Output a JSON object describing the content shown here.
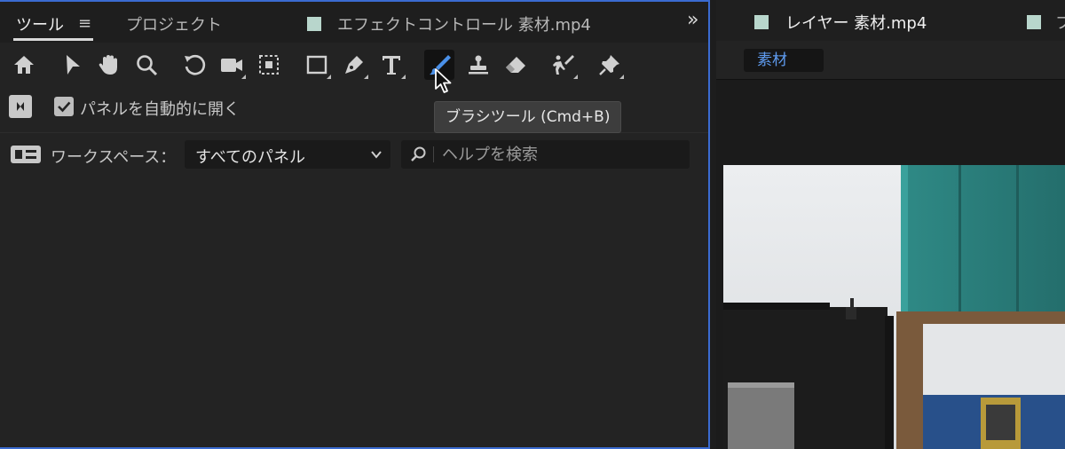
{
  "left_panel": {
    "tabs": [
      {
        "label": "ツール",
        "active": true
      },
      {
        "label": "プロジェクト",
        "active": false
      },
      {
        "label": "エフェクトコントロール 素材.mp4",
        "active": false
      }
    ],
    "menu_icon": "hamburger-icon",
    "overflow_label": "»",
    "tools": [
      {
        "name": "home",
        "icon": "home-icon"
      },
      {
        "name": "selection",
        "icon": "arrow-icon"
      },
      {
        "name": "hand",
        "icon": "hand-icon"
      },
      {
        "name": "zoom",
        "icon": "magnifier-icon"
      },
      {
        "name": "rotate",
        "icon": "rotate-icon"
      },
      {
        "name": "camera",
        "icon": "camera-icon"
      },
      {
        "name": "pan-behind",
        "icon": "anchor-move-icon"
      },
      {
        "name": "rectangle",
        "icon": "rectangle-icon"
      },
      {
        "name": "pen",
        "icon": "pen-icon"
      },
      {
        "name": "type",
        "icon": "type-icon"
      },
      {
        "name": "brush",
        "icon": "brush-icon",
        "active": true
      },
      {
        "name": "clone-stamp",
        "icon": "stamp-icon"
      },
      {
        "name": "eraser",
        "icon": "eraser-icon"
      },
      {
        "name": "roto-brush",
        "icon": "roto-brush-icon"
      },
      {
        "name": "puppet-pin",
        "icon": "pin-icon"
      }
    ],
    "tooltip": "ブラシツール (Cmd+B)",
    "auto_open": {
      "label": "パネルを自動的に開く",
      "checked": true
    },
    "workspace": {
      "label": "ワークスペース：",
      "value": "すべてのパネル"
    },
    "help_search": {
      "placeholder": "ヘルプを検索"
    }
  },
  "right_panel": {
    "tabs": [
      {
        "label": "レイヤー 素材.mp4",
        "active": true
      },
      {
        "label": "フ",
        "active": false
      }
    ],
    "layer_name": "素材"
  },
  "colors": {
    "accent": "#3a6bd0",
    "brush_active": "#4a90e8",
    "label_swatch": "#b8d6cc",
    "layer_link": "#5f9cf0"
  }
}
